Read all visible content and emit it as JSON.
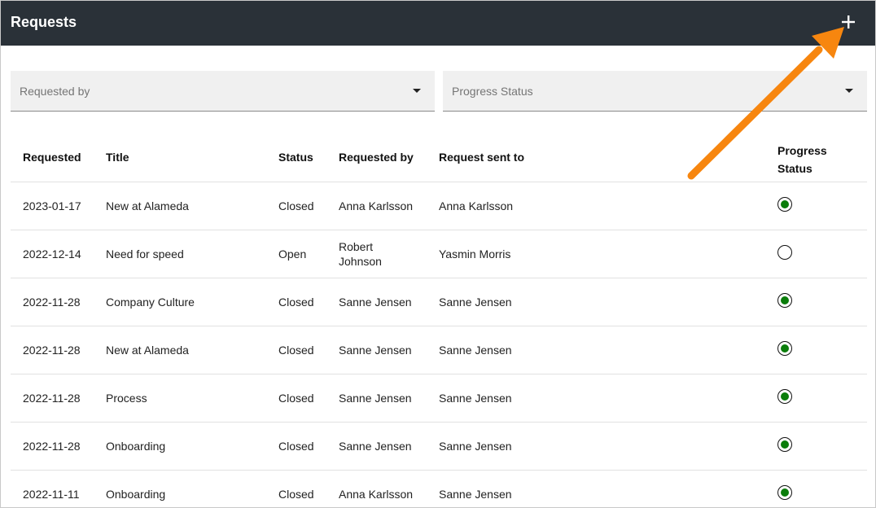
{
  "header": {
    "title": "Requests",
    "add_icon": "plus-icon"
  },
  "filters": [
    {
      "label": "Requested by",
      "icon": "chevron-down-icon"
    },
    {
      "label": "Progress Status",
      "icon": "chevron-down-icon"
    }
  ],
  "table": {
    "columns": [
      "Requested",
      "Title",
      "Status",
      "Requested by",
      "Request sent to",
      "Progress Status"
    ],
    "progress_header_lines": [
      "Progress",
      "Status"
    ],
    "rows": [
      {
        "requested": "2023-01-17",
        "title": "New at Alameda",
        "status": "Closed",
        "requested_by": "Anna Karlsson",
        "sent_to": "Anna Karlsson",
        "progress": "complete"
      },
      {
        "requested": "2022-12-14",
        "title": "Need for speed",
        "status": "Open",
        "requested_by": "Robert Johnson",
        "requested_by_lines": [
          "Robert",
          "Johnson"
        ],
        "sent_to": "Yasmin Morris",
        "progress": "incomplete"
      },
      {
        "requested": "2022-11-28",
        "title": "Company Culture",
        "status": "Closed",
        "requested_by": "Sanne Jensen",
        "sent_to": "Sanne Jensen",
        "progress": "complete"
      },
      {
        "requested": "2022-11-28",
        "title": "New at Alameda",
        "status": "Closed",
        "requested_by": "Sanne Jensen",
        "sent_to": "Sanne Jensen",
        "progress": "complete"
      },
      {
        "requested": "2022-11-28",
        "title": "Process",
        "status": "Closed",
        "requested_by": "Sanne Jensen",
        "sent_to": "Sanne Jensen",
        "progress": "complete"
      },
      {
        "requested": "2022-11-28",
        "title": "Onboarding",
        "status": "Closed",
        "requested_by": "Sanne Jensen",
        "sent_to": "Sanne Jensen",
        "progress": "complete"
      },
      {
        "requested": "2022-11-11",
        "title": "Onboarding",
        "status": "Closed",
        "requested_by": "Anna Karlsson",
        "sent_to": "Sanne Jensen",
        "progress": "complete"
      }
    ]
  },
  "colors": {
    "header_bg": "#2a3138",
    "annotation_arrow": "#f7860f",
    "progress_complete": "#0a7d0a"
  }
}
